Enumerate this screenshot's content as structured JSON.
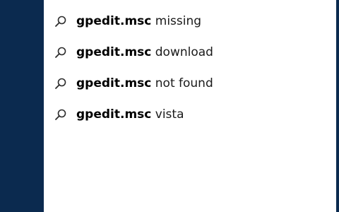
{
  "colors": {
    "rail": "#0b2a4f",
    "panel_bg": "#ffffff",
    "text": "#1a1a1a",
    "icon": "#2b2b2b"
  },
  "search": {
    "icon": "search-icon",
    "suggestions": [
      {
        "query": "gpedit.msc",
        "suffix": " missing"
      },
      {
        "query": "gpedit.msc",
        "suffix": " download"
      },
      {
        "query": "gpedit.msc",
        "suffix": " not found"
      },
      {
        "query": "gpedit.msc",
        "suffix": " vista"
      }
    ]
  }
}
